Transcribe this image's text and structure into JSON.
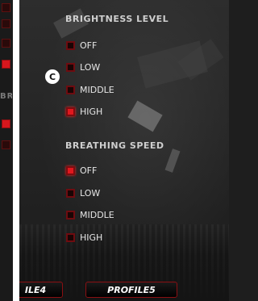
{
  "left_panel": {
    "partial_heading": "BRI",
    "checkboxes": [
      {
        "active": false
      },
      {
        "active": false
      },
      {
        "active": false
      },
      {
        "active": true
      },
      {
        "active": true
      },
      {
        "active": false
      }
    ]
  },
  "brightness": {
    "title": "BRIGHTNESS LEVEL",
    "options": [
      {
        "label": "OFF",
        "active": false
      },
      {
        "label": "LOW",
        "active": false
      },
      {
        "label": "MIDDLE",
        "active": false
      },
      {
        "label": "HIGH",
        "active": true
      }
    ]
  },
  "breathing": {
    "title": "BREATHING SPEED",
    "options": [
      {
        "label": "OFF",
        "active": true
      },
      {
        "label": "LOW",
        "active": false
      },
      {
        "label": "MIDDLE",
        "active": false
      },
      {
        "label": "HIGH",
        "active": false
      }
    ]
  },
  "marker": {
    "label": "C"
  },
  "profiles": [
    {
      "label": "ILE4"
    },
    {
      "label": "PROFILE5"
    }
  ],
  "colors": {
    "accent": "#e0181e",
    "border": "#8a0f12"
  }
}
